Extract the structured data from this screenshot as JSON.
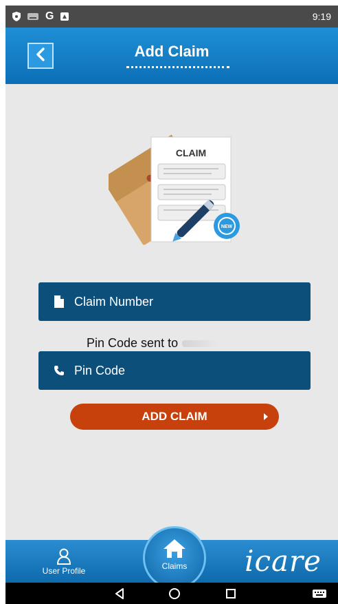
{
  "status_bar": {
    "time": "9:19"
  },
  "header": {
    "title": "Add Claim",
    "back_icon": "chevron-left-icon"
  },
  "illustration": {
    "document_title": "CLAIM",
    "badge": "NEW"
  },
  "form": {
    "claim_number_placeholder": "Claim Number",
    "pin_note": "Pin Code sent to",
    "pin_code_placeholder": "Pin Code"
  },
  "add_claim_button": "ADD CLAIM",
  "tabs": {
    "profile_label": "User Profile",
    "claims_label": "Claims"
  },
  "brand": "icare",
  "colors": {
    "header": "#1f8fd6",
    "field": "#0d4f7b",
    "button": "#c6410b",
    "background": "#e8e8e8"
  }
}
